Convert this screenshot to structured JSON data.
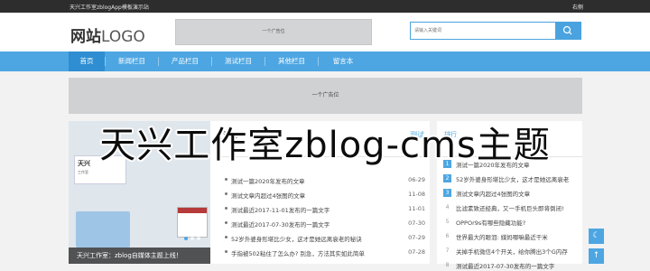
{
  "topbar": {
    "site_title": "天兴工作室zblogApp模板演示站",
    "right_link": "右侧"
  },
  "header": {
    "logo_bold": "网站",
    "logo_light": "LOGO",
    "ad_text": "一个广告位",
    "search_placeholder": "请输入关键词"
  },
  "nav": {
    "items": [
      "首页",
      "新闻栏目",
      "产品栏目",
      "测试栏目",
      "其他栏目",
      "留言本"
    ],
    "active_index": 0
  },
  "ad_banner": "一个广告位",
  "slider": {
    "logo_text": "天兴",
    "logo_sub": "工作室",
    "caption": "天兴工作室：zblog自媒体主题上线！",
    "active_dot": 0,
    "dot_count": 3
  },
  "news": {
    "tab_left": "测试",
    "tab_right": "测试",
    "items": [
      {
        "title": "测试一篇2020年发布的文章",
        "date": "06-29"
      },
      {
        "title": "测试文章内超过4张图的文章",
        "date": "11-08"
      },
      {
        "title": "测试最近2017-11-01发布的一篇文字",
        "date": "11-01"
      },
      {
        "title": "测试最近2017-07-30发布的一篇文字",
        "date": "07-30"
      },
      {
        "title": "52岁外婆身形堪比少女，这才是她远离衰老的秘诀",
        "date": "07-29"
      },
      {
        "title": "手指被502粘住了怎么办? 别急，方法其实如此简单",
        "date": "07-28"
      }
    ]
  },
  "rank": {
    "title": "排行",
    "items": [
      {
        "num": "1",
        "title": "测试一篇2020年发布的文章"
      },
      {
        "num": "2",
        "title": "52岁外婆身形堪比少女，这才是她远离衰老"
      },
      {
        "num": "3",
        "title": "测试文章内超过4张图的文章"
      },
      {
        "num": "4",
        "title": "比滤素致还经典，又一手机巨头即将倒闭!"
      },
      {
        "num": "5",
        "title": "OPPOr9s有哪些隐藏功能?"
      },
      {
        "num": "6",
        "title": "世界最大的眼泪: 媒妈哪嘛最近干米"
      },
      {
        "num": "7",
        "title": "关掉手机微信4个开关，给你腾出3个G内存"
      },
      {
        "num": "8",
        "title": "测试最近2017-07-30发布的一篇文字"
      }
    ]
  },
  "tools": {
    "theme_icon": "moon-icon",
    "theme_label": "夜",
    "top_icon": "arrow-up-icon"
  },
  "overlay_title": "天兴工作室zblog-cms主题"
}
